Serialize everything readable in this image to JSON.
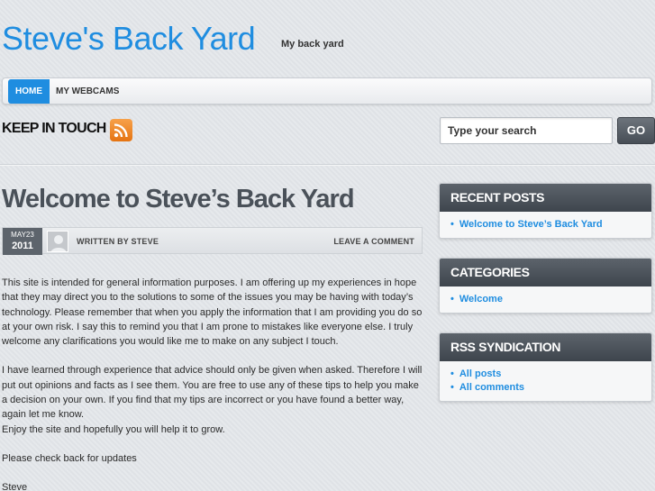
{
  "site": {
    "title": "Steve's Back Yard",
    "description": "My back yard"
  },
  "nav": {
    "items": [
      {
        "label": "HOME",
        "active": true
      },
      {
        "label": "MY WEBCAMS",
        "active": false
      }
    ]
  },
  "social": {
    "keep_in_touch": "KEEP IN TOUCH",
    "icon": "rss-icon"
  },
  "search": {
    "placeholder": "Type your search",
    "button_label": "GO"
  },
  "post": {
    "title": "Welcome to Steve’s Back Yard",
    "date_month_day": "MAY23",
    "date_year": "2011",
    "written_by": "WRITTEN BY STEVE",
    "leave_comment": "LEAVE A COMMENT",
    "paragraphs": [
      "This site is intended for general information purposes. I am offering up my experiences in hope that they may direct you to the solutions to some of the issues you may be having with today’s technology. Please remember that when you apply the information that I am providing you do so at your own risk. I say this to remind you that I am prone to mistakes like everyone else. I truly welcome any clarifications you would like me to make on any subject I touch.",
      "I have learned through experience that advice should only be given when asked. Therefore I will put out opinions and facts as I see them. You are free to use any of these tips to help you make a decision on your own. If you find that my tips are incorrect or you have found a better way, again let me know.",
      "Enjoy the site and hopefully you will help it to grow.",
      "Please check back for updates",
      "Steve"
    ]
  },
  "sidebar": {
    "recent_posts": {
      "title": "RECENT POSTS",
      "items": [
        "Welcome to Steve’s Back Yard"
      ]
    },
    "categories": {
      "title": "CATEGORIES",
      "items": [
        "Welcome"
      ]
    },
    "rss": {
      "title": "RSS SYNDICATION",
      "items": [
        "All posts",
        "All comments"
      ]
    }
  },
  "colors": {
    "accent": "#1f8de0",
    "widget_header": "#4a5159",
    "rss_orange": "#e57412"
  }
}
